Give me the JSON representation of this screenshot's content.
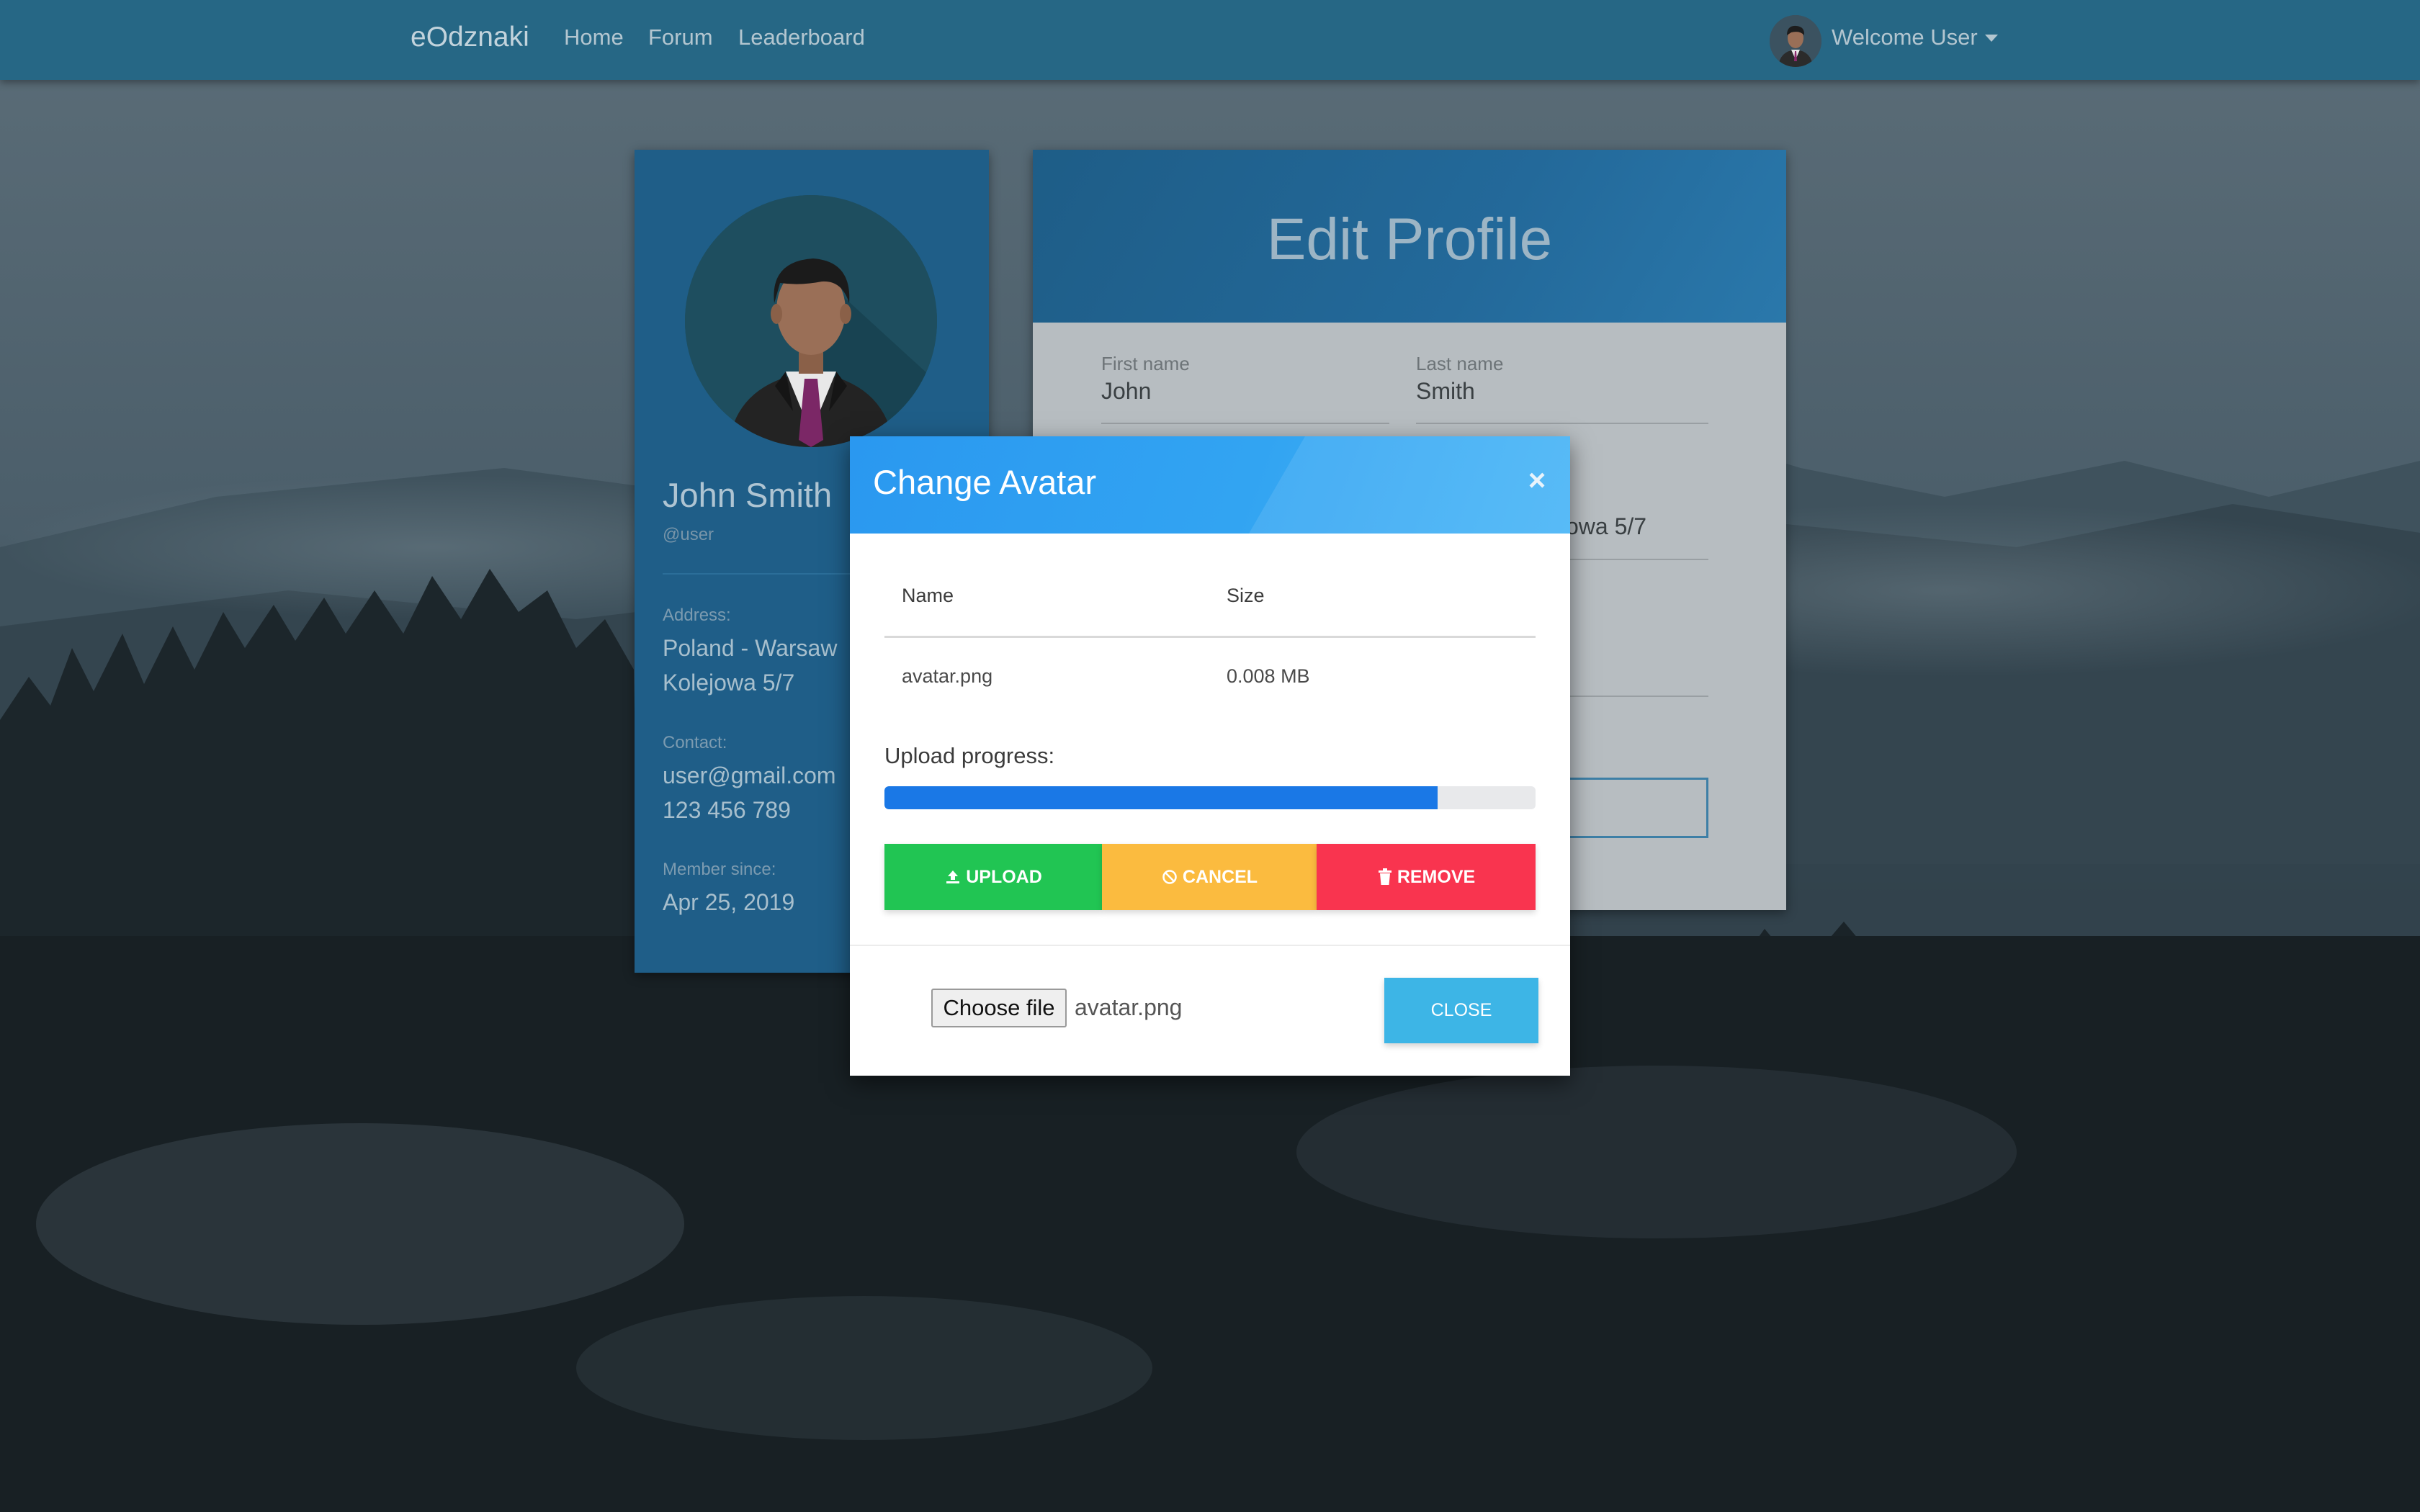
{
  "navbar": {
    "brand": "eOdznaki",
    "links": [
      "Home",
      "Forum",
      "Leaderboard"
    ],
    "welcome": "Welcome User"
  },
  "profile_card": {
    "name": "John Smith",
    "handle": "@user",
    "address_label": "Address:",
    "address_line1": "Poland - Warsaw",
    "address_line2": "Kolejowa 5/7",
    "contact_label": "Contact:",
    "email": "user@gmail.com",
    "phone": "123 456 789",
    "member_label": "Member since:",
    "member_since": "Apr 25, 2019"
  },
  "edit_profile": {
    "title": "Edit Profile",
    "first_name_label": "First name",
    "first_name": "John",
    "last_name_label": "Last name",
    "last_name": "Smith",
    "address_partial": "owa 5/7"
  },
  "modal": {
    "title": "Change Avatar",
    "close_icon": "×",
    "table": {
      "headers": [
        "Name",
        "Size"
      ],
      "rows": [
        [
          "avatar.png",
          "0.008 MB"
        ]
      ]
    },
    "progress_label": "Upload progress:",
    "progress_fraction": 0.85,
    "upload_label": "UPLOAD",
    "cancel_label": "CANCEL",
    "remove_label": "REMOVE",
    "choose_file_label": "Choose file",
    "chosen_file": "avatar.png",
    "close_label": "CLOSE",
    "colors": {
      "header": "#2a98f0",
      "upload": "#21c553",
      "cancel": "#fbbb3f",
      "remove": "#f9344f",
      "progress": "#1a78e6",
      "close": "#3db5e6"
    }
  }
}
